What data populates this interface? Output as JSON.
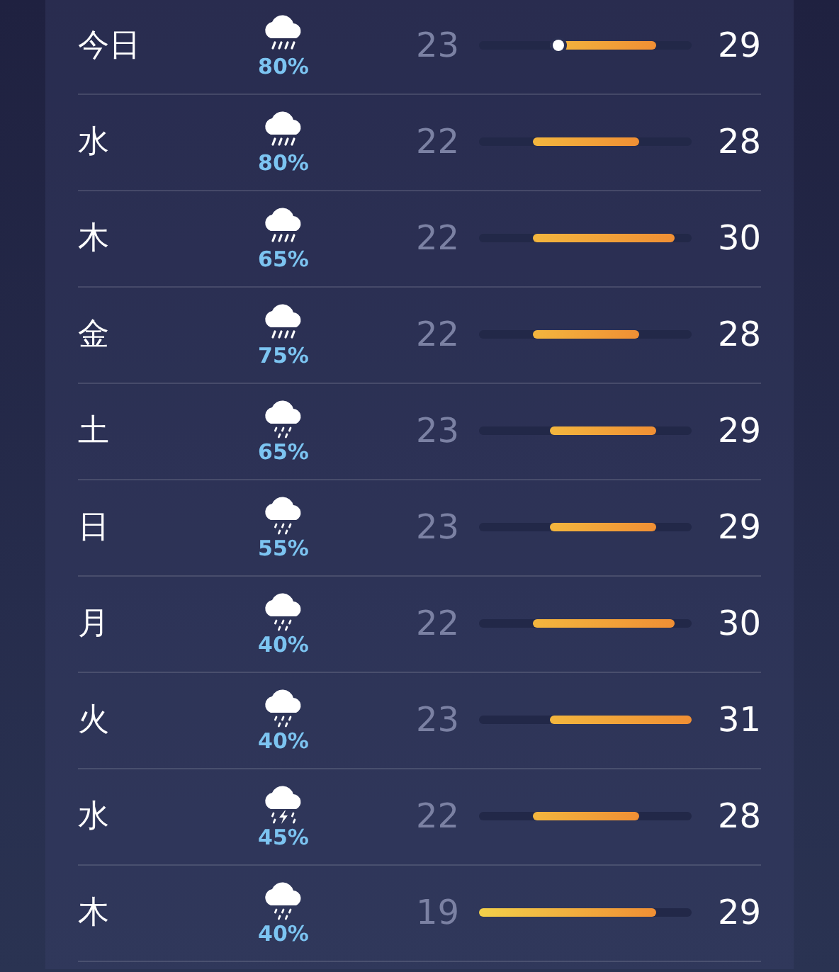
{
  "forecast": [
    {
      "day": "今日",
      "kind": "heavy-rain",
      "chance": "80%",
      "low": "23",
      "high": "29",
      "now_marker": true
    },
    {
      "day": "水",
      "kind": "heavy-rain",
      "chance": "80%",
      "low": "22",
      "high": "28",
      "now_marker": false
    },
    {
      "day": "木",
      "kind": "heavy-rain",
      "chance": "65%",
      "low": "22",
      "high": "30",
      "now_marker": false
    },
    {
      "day": "金",
      "kind": "heavy-rain",
      "chance": "75%",
      "low": "22",
      "high": "28",
      "now_marker": false
    },
    {
      "day": "土",
      "kind": "rain",
      "chance": "65%",
      "low": "23",
      "high": "29",
      "now_marker": false
    },
    {
      "day": "日",
      "kind": "rain",
      "chance": "55%",
      "low": "23",
      "high": "29",
      "now_marker": false
    },
    {
      "day": "月",
      "kind": "rain",
      "chance": "40%",
      "low": "22",
      "high": "30",
      "now_marker": false
    },
    {
      "day": "火",
      "kind": "rain",
      "chance": "40%",
      "low": "23",
      "high": "31",
      "now_marker": false
    },
    {
      "day": "水",
      "kind": "thunderstorm",
      "chance": "45%",
      "low": "22",
      "high": "28",
      "now_marker": false
    },
    {
      "day": "木",
      "kind": "rain",
      "chance": "40%",
      "low": "19",
      "high": "29",
      "now_marker": false
    }
  ]
}
